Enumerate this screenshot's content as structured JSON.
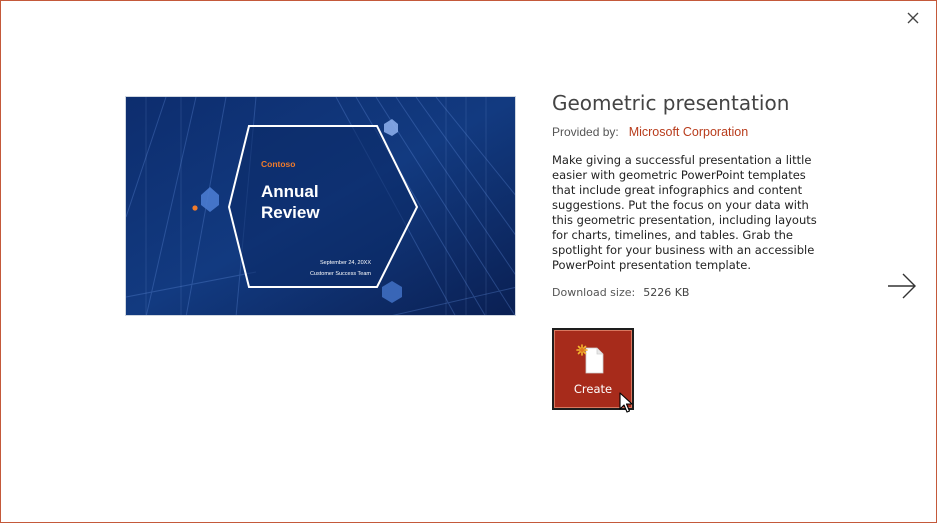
{
  "template": {
    "title": "Geometric presentation",
    "provided_by_label": "Provided by:",
    "provider": "Microsoft Corporation",
    "description": "Make giving a successful presentation a little easier with geometric PowerPoint templates that include great infographics and content suggestions. Put the focus on your data with this geometric presentation, including layouts for charts, timelines, and tables. Grab the spotlight for your business with an accessible PowerPoint presentation template.",
    "download_size_label": "Download size:",
    "download_size_value": "5226 KB"
  },
  "preview_slide": {
    "company": "Contoso",
    "title_line1": "Annual",
    "title_line2": "Review",
    "date": "September 24, 20XX",
    "team": "Customer Success Team"
  },
  "actions": {
    "create_label": "Create"
  },
  "icons": {
    "close": "close-icon",
    "next": "arrow-right-icon",
    "create": "new-document-icon"
  },
  "colors": {
    "accent": "#a72b1b",
    "provider_link": "#b83c1c",
    "dialog_border": "#c4593a",
    "slide_accent": "#f07b2b"
  }
}
